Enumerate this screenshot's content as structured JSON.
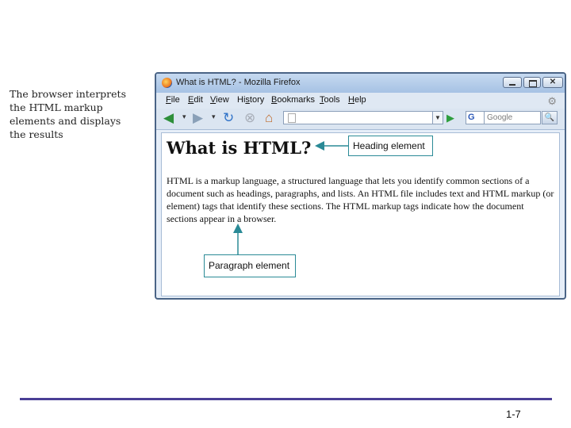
{
  "caption": {
    "lines": [
      "The browser interprets",
      "the HTML markup",
      "elements and displays",
      "the results"
    ]
  },
  "window": {
    "title": "What is HTML? - Mozilla Firefox",
    "close_glyph": "✕"
  },
  "menu": {
    "items": [
      {
        "accel": "F",
        "rest": "ile"
      },
      {
        "accel": "E",
        "rest": "dit"
      },
      {
        "accel": "V",
        "rest": "iew"
      },
      {
        "accel": "",
        "rest": "Hi",
        "accel2": "s",
        "rest2": "tory"
      },
      {
        "accel": "B",
        "rest": "ookmarks"
      },
      {
        "accel": "T",
        "rest": "ools"
      },
      {
        "accel": "H",
        "rest": "elp"
      }
    ]
  },
  "toolbar": {
    "icons": [
      "back-icon",
      "forward-icon",
      "reload-icon",
      "stop-icon",
      "home-icon"
    ],
    "search_engine_glyph": "G",
    "search_placeholder": "Google",
    "url_value": ""
  },
  "page": {
    "heading": "What is HTML?",
    "paragraph": "HTML is a markup language, a structured language that lets you identify common sections of a document such as headings, paragraphs, and lists. An HTML file includes text and HTML markup (or element) tags that identify these sections. The HTML markup tags indicate how the document sections appear in a browser."
  },
  "callouts": {
    "heading": "Heading element",
    "paragraph": "Paragraph element"
  },
  "colors": {
    "callout_border": "#2a8a96",
    "footer_rule": "#4a3f96"
  },
  "footer": {
    "page_number": "1-7"
  }
}
